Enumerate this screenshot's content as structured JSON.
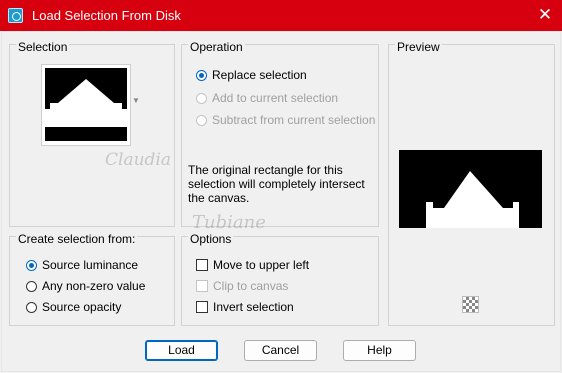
{
  "window": {
    "title": "Load Selection From Disk",
    "close_label": "✕",
    "accent_color": "#d7000f"
  },
  "selection_group": {
    "title": "Selection"
  },
  "operation_group": {
    "title": "Operation",
    "options": [
      {
        "label": "Replace selection",
        "selected": true,
        "enabled": true
      },
      {
        "label": "Add to current selection",
        "selected": false,
        "enabled": false
      },
      {
        "label": "Subtract from current selection",
        "selected": false,
        "enabled": false
      }
    ],
    "note": "The original rectangle for this selection will completely intersect the canvas."
  },
  "preview_group": {
    "title": "Preview"
  },
  "create_from_group": {
    "title": "Create selection from:",
    "options": [
      {
        "label": "Source luminance",
        "selected": true
      },
      {
        "label": "Any non-zero value",
        "selected": false
      },
      {
        "label": "Source opacity",
        "selected": false
      }
    ]
  },
  "options_group": {
    "title": "Options",
    "items": [
      {
        "label": "Move to upper left",
        "checked": false,
        "enabled": true
      },
      {
        "label": "Clip to canvas",
        "checked": false,
        "enabled": false
      },
      {
        "label": "Invert selection",
        "checked": false,
        "enabled": true
      }
    ]
  },
  "buttons": {
    "load": "Load",
    "cancel": "Cancel",
    "help": "Help"
  },
  "watermark": {
    "line1": "Claudia",
    "line2": "Tubiane"
  }
}
